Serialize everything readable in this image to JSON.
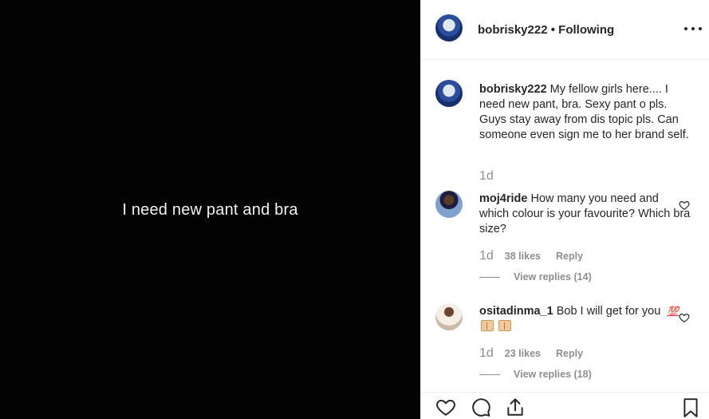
{
  "media": {
    "caption": "I need new pant and bra",
    "background": "#030303"
  },
  "header": {
    "username": "bobrisky222",
    "separator": "•",
    "follow_status": "Following",
    "more_icon": "more-horizontal-icon"
  },
  "post": {
    "username": "bobrisky222",
    "text": "My fellow girls here.... I need new pant, bra. Sexy pant o pls. Guys stay away from dis topic pls. Can someone even sign me to her brand self.",
    "time": "1d"
  },
  "comments": [
    {
      "username": "moj4ride",
      "text": "How many you need and which colour is your favourite? Which bra size?",
      "time": "1d",
      "likes": "38 likes",
      "reply_label": "Reply",
      "view_replies": "View replies (14)"
    },
    {
      "username": "ositadinma_1",
      "text": "Bob I will get for you",
      "emoji": "💯",
      "time": "1d",
      "likes": "23 likes",
      "reply_label": "Reply",
      "view_replies": "View replies (18)"
    }
  ],
  "actions": {
    "icons": [
      "heart-icon",
      "comment-icon",
      "share-icon",
      "bookmark-icon"
    ]
  },
  "colors": {
    "text": "#262626",
    "muted": "#8e8e8e",
    "border": "#efefef"
  }
}
